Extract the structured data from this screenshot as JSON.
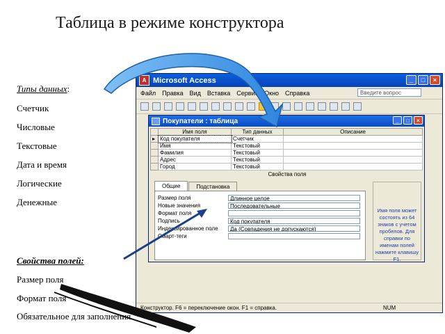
{
  "slide": {
    "title": "Таблица в режиме конструктора",
    "data_types_header": "Типы данных",
    "data_types_colon": ":",
    "data_types": [
      "Счетчик",
      "Числовые",
      "Текстовые",
      "Дата и время",
      "Логические",
      "Денежные"
    ],
    "field_props_header": "Свойства полей:",
    "field_props": [
      "Размер поля",
      "Формат поля",
      "Обязательное для заполнения"
    ]
  },
  "app": {
    "title": "Microsoft Access",
    "menu": [
      "Файл",
      "Правка",
      "Вид",
      "Вставка",
      "Сервис",
      "Окно",
      "Справка"
    ],
    "help_placeholder": "Введите вопрос",
    "window_buttons": [
      "_",
      "□",
      "×"
    ]
  },
  "table_window": {
    "title": "Покупатели : таблица",
    "columns": [
      "Имя поля",
      "Тип данных",
      "Описание"
    ],
    "rows": [
      {
        "name": "Код покупателя",
        "type": "Счетчик",
        "desc": ""
      },
      {
        "name": "Имя",
        "type": "Текстовый",
        "desc": ""
      },
      {
        "name": "Фамилия",
        "type": "Текстовый",
        "desc": ""
      },
      {
        "name": "Адрес",
        "type": "Текстовый",
        "desc": ""
      },
      {
        "name": "Город",
        "type": "Текстовый",
        "desc": ""
      }
    ],
    "props_label": "Свойства поля",
    "tabs": [
      "Общие",
      "Подстановка"
    ],
    "props": [
      {
        "label": "Размер поля",
        "value": "Длинное целое"
      },
      {
        "label": "Новые значения",
        "value": "Последовательные"
      },
      {
        "label": "Формат поля",
        "value": ""
      },
      {
        "label": "Подпись",
        "value": "Код покупателя"
      },
      {
        "label": "Индексированное поле",
        "value": "Да (Совпадения не допускаются)"
      },
      {
        "label": "Смарт-теги",
        "value": ""
      }
    ],
    "hint": "Имя поля может состоять из 64 знаков с учетом пробелов. Для справки по именам полей нажмите клавишу F1."
  },
  "status": {
    "text": "Конструктор. F6 = переключение окон. F1 = справка.",
    "num": "NUM"
  },
  "colors": {
    "arrow_fill": "#3a8fe0",
    "arrow_stroke": "#1f5fa8"
  }
}
